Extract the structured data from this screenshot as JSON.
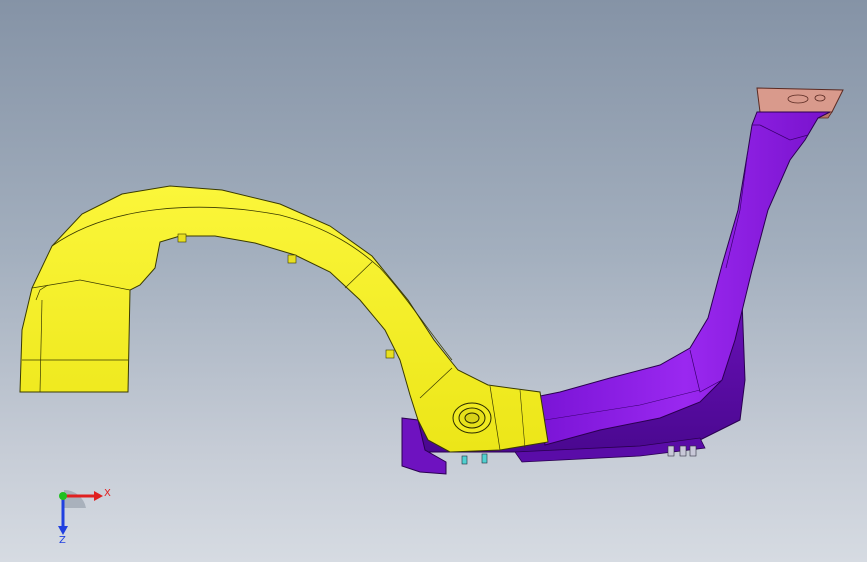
{
  "viewport": {
    "colors": {
      "background_top": "#8593a6",
      "background_bottom": "#d6dbe2",
      "part_yellow": "#f7f21f",
      "part_purple": "#8d1de8",
      "part_pink": "#d99a8c"
    }
  },
  "triad": {
    "x_label": "X",
    "z_label": "Z",
    "colors": {
      "x": "#e02020",
      "y": "#20c020",
      "z": "#2040e0"
    }
  }
}
